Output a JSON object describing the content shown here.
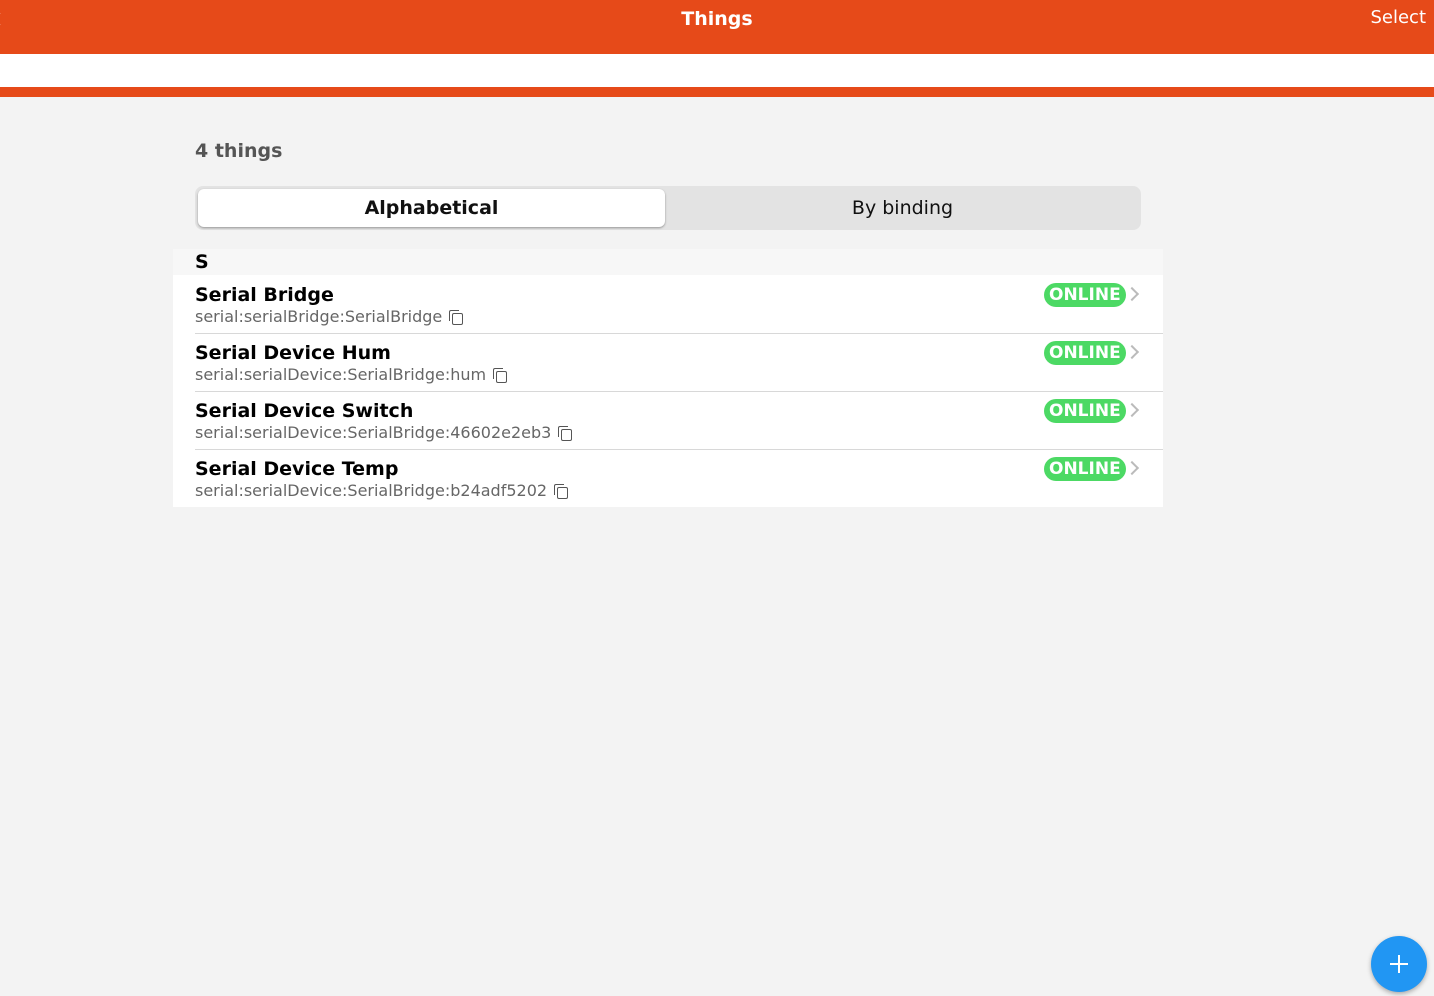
{
  "navbar": {
    "title": "Things",
    "right_action": "Select",
    "color": "#e64a19"
  },
  "search": {
    "value": "",
    "placeholder": ""
  },
  "summary": {
    "count_text": "4 things"
  },
  "sort_tabs": [
    {
      "label": "Alphabetical",
      "active": true
    },
    {
      "label": "By binding",
      "active": false
    }
  ],
  "groups": [
    {
      "title": "S",
      "items": [
        {
          "title": "Serial Bridge",
          "uid": "serial:serialBridge:SerialBridge",
          "status": "ONLINE"
        },
        {
          "title": "Serial Device Hum",
          "uid": "serial:serialDevice:SerialBridge:hum",
          "status": "ONLINE"
        },
        {
          "title": "Serial Device Switch",
          "uid": "serial:serialDevice:SerialBridge:46602e2eb3",
          "status": "ONLINE"
        },
        {
          "title": "Serial Device Temp",
          "uid": "serial:serialDevice:SerialBridge:b24adf5202",
          "status": "ONLINE"
        }
      ]
    }
  ],
  "status_color": "#4cd964",
  "fab": {
    "icon": "plus-icon",
    "color": "#2196f3"
  }
}
